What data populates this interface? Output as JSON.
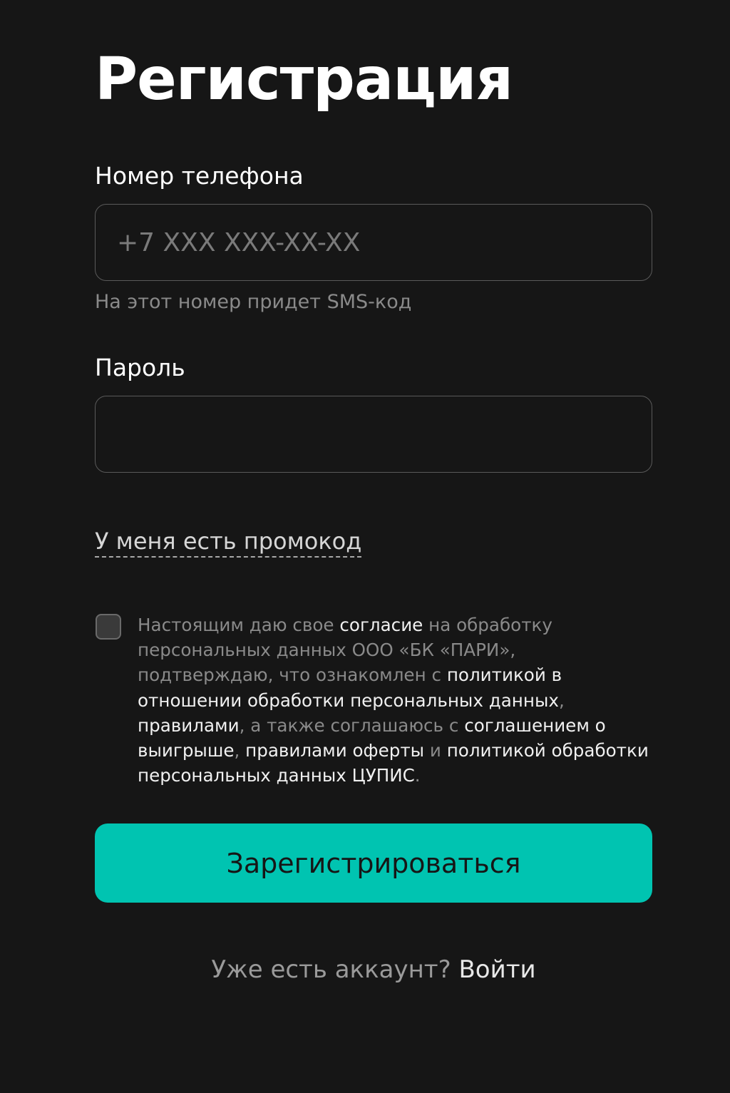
{
  "page": {
    "title": "Регистрация"
  },
  "phone": {
    "label": "Номер телефона",
    "placeholder": "+7 XXX XXX-XX-XX",
    "value": "",
    "hint": "На этот номер придет SMS-код"
  },
  "password": {
    "label": "Пароль",
    "value": ""
  },
  "promo": {
    "link_label": "У меня есть промокод"
  },
  "consent": {
    "checked": false,
    "t1": "Настоящим даю свое ",
    "l1": "согласие",
    "t2": " на обработку персональных данных ООО «БК «ПАРИ», подтверждаю, что ознакомлен с ",
    "l2": "политикой в отношении обработки персональных данных",
    "t3": ", ",
    "l3": "правилами",
    "t4": ", а также соглашаюсь с ",
    "l4": "соглашением о выигрыше",
    "t5": ", ",
    "l5": "правилами оферты",
    "t6": " и ",
    "l6": "политикой обработки персональных данных ЦУПИС",
    "t7": "."
  },
  "submit": {
    "label": "Зарегистрироваться"
  },
  "login": {
    "question": "Уже есть аккаунт?",
    "link_label": "Войти"
  },
  "colors": {
    "background": "#161616",
    "accent": "#00c4b1",
    "muted_text": "#8a8a8a",
    "input_border": "#5a5a5a"
  }
}
